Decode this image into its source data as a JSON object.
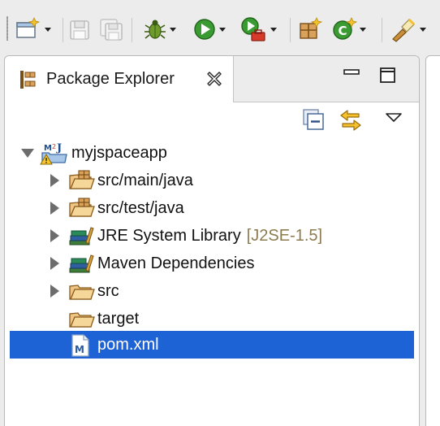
{
  "toolbar": {
    "buttons": [
      {
        "name": "new-wizard",
        "icon": "new-window-icon"
      },
      {
        "name": "save",
        "icon": "save-icon"
      },
      {
        "name": "save-all",
        "icon": "save-all-icon"
      },
      {
        "name": "debug",
        "icon": "bug-icon"
      },
      {
        "name": "run",
        "icon": "run-icon"
      },
      {
        "name": "external-tools",
        "icon": "external-tools-icon"
      },
      {
        "name": "new-java-package",
        "icon": "new-package-icon"
      },
      {
        "name": "new-java-class",
        "icon": "new-class-icon"
      },
      {
        "name": "search",
        "icon": "flashlight-icon"
      }
    ]
  },
  "view": {
    "tab_label": "Package Explorer",
    "tab_icon": "package-explorer-icon",
    "close_icon": "close-icon",
    "minimize_icon": "minimize-icon",
    "maximize_icon": "maximize-icon",
    "tools": {
      "collapse_all_icon": "collapse-all-icon",
      "link_with_editor_icon": "link-with-editor-icon",
      "view_menu_icon": "view-menu-icon"
    }
  },
  "tree": {
    "project": {
      "label": "myjspaceapp",
      "icon": "maven-java-project-warning-icon",
      "expanded": true
    },
    "children": [
      {
        "label": "src/main/java",
        "decoration": "",
        "icon": "source-folder-icon",
        "expandable": true,
        "selected": false
      },
      {
        "label": "src/test/java",
        "decoration": "",
        "icon": "source-folder-icon",
        "expandable": true,
        "selected": false
      },
      {
        "label": "JRE System Library",
        "decoration": "[J2SE-1.5]",
        "icon": "library-icon",
        "expandable": true,
        "selected": false
      },
      {
        "label": "Maven Dependencies",
        "decoration": "",
        "icon": "library-icon",
        "expandable": true,
        "selected": false
      },
      {
        "label": "src",
        "decoration": "",
        "icon": "folder-icon",
        "expandable": true,
        "selected": false
      },
      {
        "label": "target",
        "decoration": "",
        "icon": "folder-icon",
        "expandable": false,
        "selected": false
      },
      {
        "label": "pom.xml",
        "decoration": "",
        "icon": "maven-pom-file-icon",
        "expandable": false,
        "selected": true
      }
    ]
  },
  "colors": {
    "selection": "#1e63d6",
    "decoration": "#8b7b4e",
    "background": "#ececec"
  }
}
